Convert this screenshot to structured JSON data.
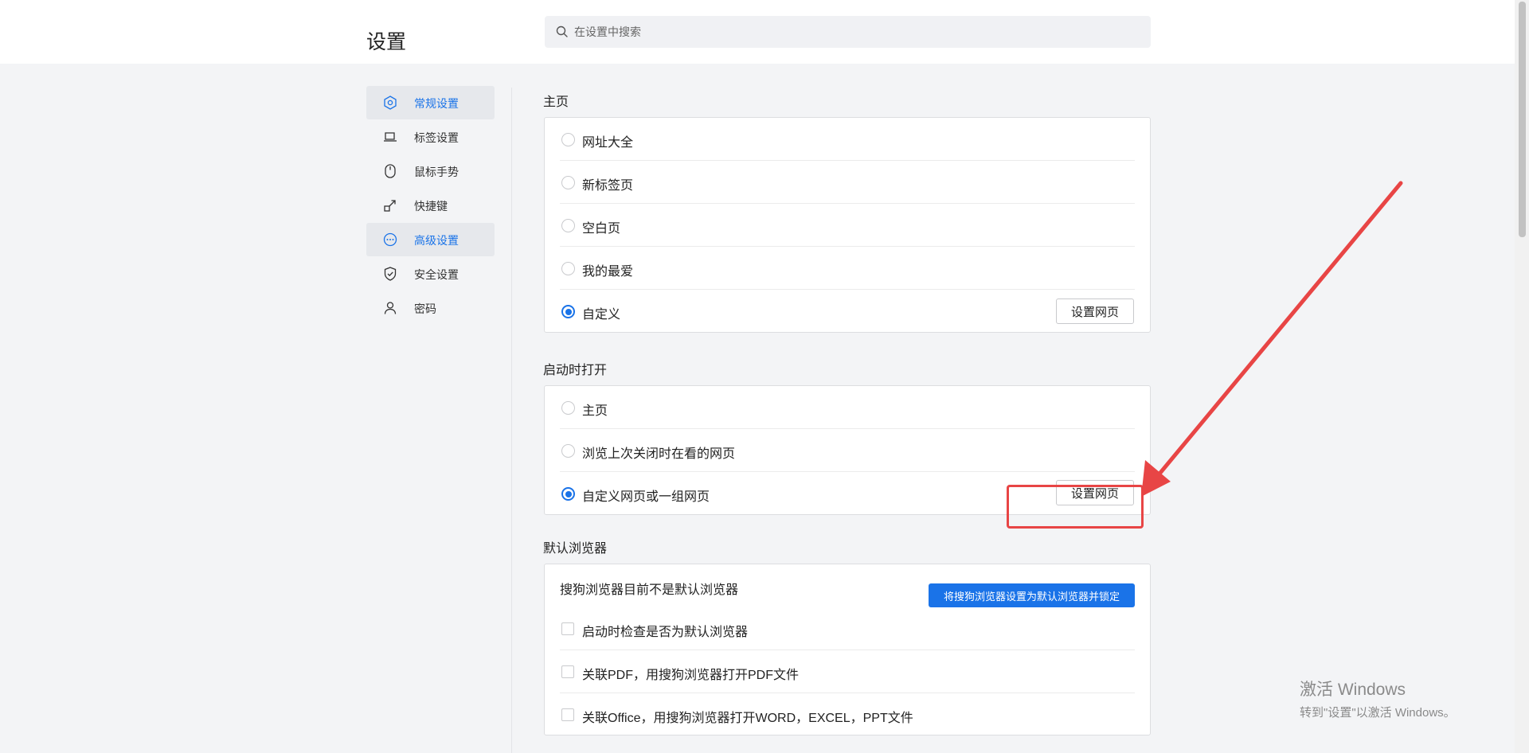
{
  "header": {
    "title": "设置",
    "search": {
      "placeholder": "在设置中搜索",
      "value": ""
    }
  },
  "sidebar": {
    "items": [
      {
        "label": "常规设置",
        "icon": "hexagon-gear-icon",
        "active": true
      },
      {
        "label": "标签设置",
        "icon": "tab-icon",
        "active": false
      },
      {
        "label": "鼠标手势",
        "icon": "mouse-icon",
        "active": false
      },
      {
        "label": "快捷键",
        "icon": "shortcut-arrow-icon",
        "active": false
      },
      {
        "label": "高级设置",
        "icon": "more-dots-icon",
        "active": true
      },
      {
        "label": "安全设置",
        "icon": "shield-icon",
        "active": false
      },
      {
        "label": "密码",
        "icon": "user-icon",
        "active": false
      }
    ]
  },
  "homepage": {
    "title": "主页",
    "options": [
      {
        "label": "网址大全",
        "checked": false
      },
      {
        "label": "新标签页",
        "checked": false
      },
      {
        "label": "空白页",
        "checked": false
      },
      {
        "label": "我的最爱",
        "checked": false
      },
      {
        "label": "自定义",
        "checked": true
      }
    ],
    "set_button": "设置网页"
  },
  "startup": {
    "title": "启动时打开",
    "options": [
      {
        "label": "主页",
        "checked": false
      },
      {
        "label": "浏览上次关闭时在看的网页",
        "checked": false
      },
      {
        "label": "自定义网页或一组网页",
        "checked": true
      }
    ],
    "set_button": "设置网页"
  },
  "default_browser": {
    "title": "默认浏览器",
    "status": "搜狗浏览器目前不是默认浏览器",
    "set_default_button": "将搜狗浏览器设置为默认浏览器并锁定",
    "checkboxes": [
      {
        "label": "启动时检查是否为默认浏览器",
        "checked": false
      },
      {
        "label": "关联PDF，用搜狗浏览器打开PDF文件",
        "checked": false
      },
      {
        "label": "关联Office，用搜狗浏览器打开WORD，EXCEL，PPT文件",
        "checked": false
      }
    ]
  },
  "watermark": {
    "title": "激活 Windows",
    "subtitle": "转到\"设置\"以激活 Windows。"
  },
  "colors": {
    "accent": "#1a73e8",
    "annotation": "#e84545"
  }
}
